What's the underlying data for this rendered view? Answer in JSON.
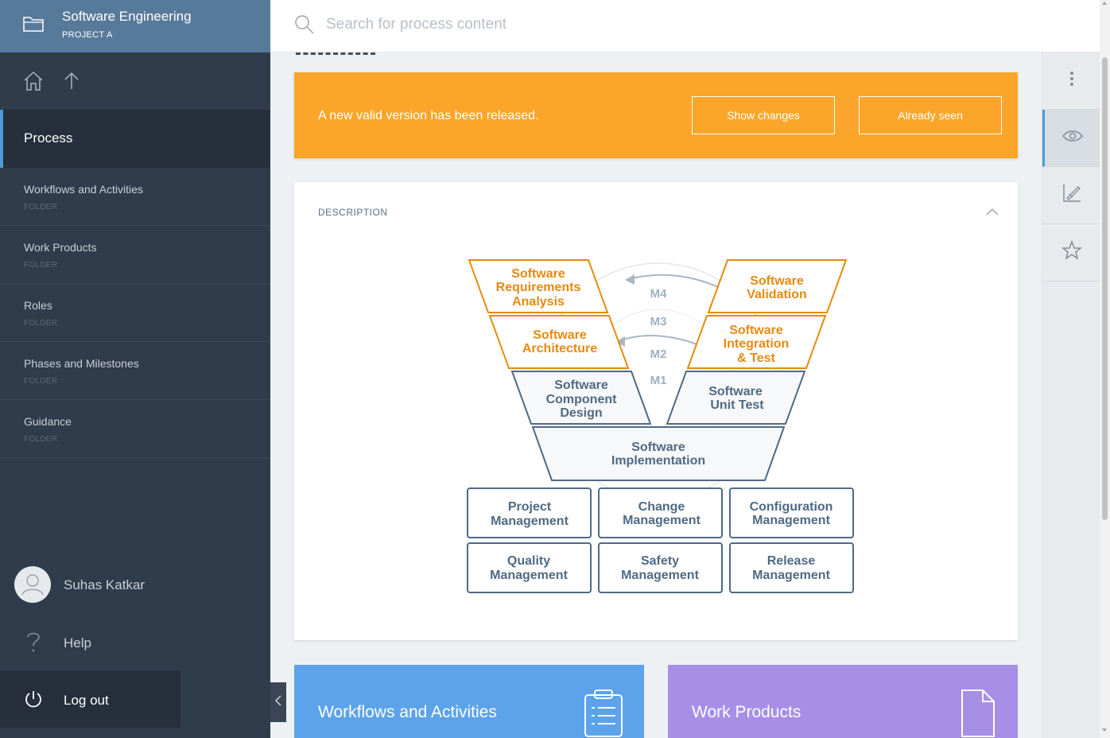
{
  "sidebar": {
    "header": {
      "title": "Software Engineering",
      "subtitle": "PROJECT A"
    },
    "active_item": "Process",
    "items": [
      {
        "label": "Workflows and Activities",
        "type": "FOLDER"
      },
      {
        "label": "Work Products",
        "type": "FOLDER"
      },
      {
        "label": "Roles",
        "type": "FOLDER"
      },
      {
        "label": "Phases and Milestones",
        "type": "FOLDER"
      },
      {
        "label": "Guidance",
        "type": "FOLDER"
      }
    ],
    "user_name": "Suhas Katkar",
    "help_label": "Help",
    "logout_label": "Log out"
  },
  "search": {
    "placeholder": "Search for process content"
  },
  "banner": {
    "message": "A new valid version has been released.",
    "show_changes": "Show changes",
    "already_seen": "Already seen",
    "color": "#fba62a"
  },
  "description": {
    "header": "DESCRIPTION",
    "diagram": {
      "left_phases": [
        "Software Requirements Analysis",
        "Software Architecture",
        "Software Component Design"
      ],
      "right_phases": [
        "Software Validation",
        "Software Integration & Test",
        "Software Unit Test"
      ],
      "bottom_phase": "Software Implementation",
      "milestones": [
        "M4",
        "M3",
        "M2",
        "M1"
      ],
      "support_processes": [
        "Project Management",
        "Change Management",
        "Configuration Management",
        "Quality Management",
        "Safety Management",
        "Release Management"
      ],
      "orange": "#e8890f",
      "blue_grey": "#4f6a84"
    }
  },
  "tiles": [
    {
      "label": "Workflows and Activities",
      "color": "#5ca3ea",
      "icon": "clipboard-list-icon"
    },
    {
      "label": "Work Products",
      "color": "#a78fe8",
      "icon": "document-icon"
    }
  ],
  "rail": {
    "icons": [
      "more-vertical-icon",
      "eye-icon",
      "chart-edit-icon",
      "star-icon"
    ]
  }
}
